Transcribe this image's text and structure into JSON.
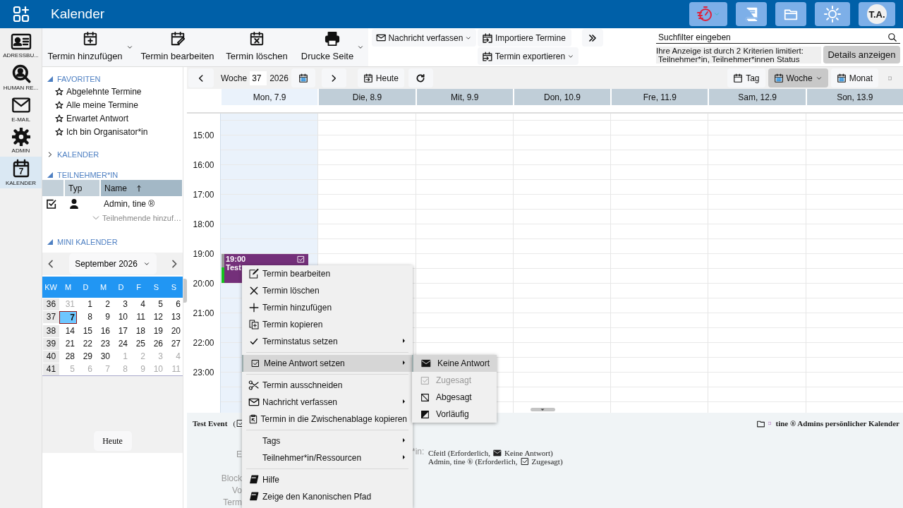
{
  "app": {
    "title": "Kalender",
    "avatar": "T.A."
  },
  "rail": [
    {
      "label": "ADRESSBU...",
      "selected": false
    },
    {
      "label": "HUMAN RE...",
      "selected": false
    },
    {
      "label": "E-MAIL",
      "selected": false
    },
    {
      "label": "ADMIN",
      "selected": false
    },
    {
      "label": "KALENDER",
      "selected": true,
      "day": "7"
    }
  ],
  "toolbar": {
    "actions": [
      {
        "label": "Termin hinzufügen",
        "dropdown": true
      },
      {
        "label": "Termin bearbeiten",
        "dropdown": false
      },
      {
        "label": "Termin löschen",
        "dropdown": false
      },
      {
        "label": "Drucke Seite",
        "dropdown": true
      }
    ],
    "small_actions": [
      {
        "label": "Nachricht verfassen",
        "dropdown": true
      },
      {
        "label": "Importiere Termine",
        "dropdown": false
      },
      {
        "label": "Termin exportieren",
        "dropdown": true
      }
    ],
    "search": {
      "placeholder": "Suchfilter eingeben"
    },
    "filter_notice": {
      "line_1": "Ihre Anzeige ist durch 2 Kriterien limitiert:",
      "line_2": "Teilnehmer*in, Teilnehmer*innen Status",
      "button": "Details anzeigen"
    }
  },
  "sidebar": {
    "favorites": {
      "title": "FAVORITEN",
      "expanded": true,
      "items": [
        "Abgelehnte Termine",
        "Alle meine Termine",
        "Erwartet Antwort",
        "Ich bin Organisator*in"
      ]
    },
    "calendars": {
      "title": "KALENDER",
      "expanded": false
    },
    "attendees": {
      "title": "TEILNEHMER*IN",
      "expanded": true,
      "columns": [
        {
          "label": "Typ",
          "sorted": false
        },
        {
          "label": "Name",
          "sorted": true
        }
      ],
      "rows": [
        {
          "checked": true,
          "name": "Admin, tine ®"
        }
      ],
      "add_placeholder": "Teilnehmende hinzuf…"
    },
    "mini_calendar": {
      "title": "MINI KALENDER",
      "expanded": true,
      "month": "September 2026",
      "header": [
        "KW",
        "M",
        "D",
        "M",
        "D",
        "F",
        "S",
        "S"
      ],
      "weeks": [
        {
          "week": "36",
          "days": [
            {
              "label": "31",
              "outside": true,
              "selected": false
            },
            {
              "label": "1",
              "outside": false,
              "selected": false
            },
            {
              "label": "2",
              "outside": false,
              "selected": false
            },
            {
              "label": "3",
              "outside": false,
              "selected": false
            },
            {
              "label": "4",
              "outside": false,
              "selected": false
            },
            {
              "label": "5",
              "outside": false,
              "selected": false
            },
            {
              "label": "6",
              "outside": false,
              "selected": false
            }
          ]
        },
        {
          "week": "37",
          "days": [
            {
              "label": "7",
              "outside": false,
              "selected": true
            },
            {
              "label": "8",
              "outside": false,
              "selected": false
            },
            {
              "label": "9",
              "outside": false,
              "selected": false
            },
            {
              "label": "10",
              "outside": false,
              "selected": false
            },
            {
              "label": "11",
              "outside": false,
              "selected": false
            },
            {
              "label": "12",
              "outside": false,
              "selected": false
            },
            {
              "label": "13",
              "outside": false,
              "selected": false
            }
          ]
        },
        {
          "week": "38",
          "days": [
            {
              "label": "14",
              "outside": false,
              "selected": false
            },
            {
              "label": "15",
              "outside": false,
              "selected": false
            },
            {
              "label": "16",
              "outside": false,
              "selected": false
            },
            {
              "label": "17",
              "outside": false,
              "selected": false
            },
            {
              "label": "18",
              "outside": false,
              "selected": false
            },
            {
              "label": "19",
              "outside": false,
              "selected": false
            },
            {
              "label": "20",
              "outside": false,
              "selected": false
            }
          ]
        },
        {
          "week": "39",
          "days": [
            {
              "label": "21",
              "outside": false,
              "selected": false
            },
            {
              "label": "22",
              "outside": false,
              "selected": false
            },
            {
              "label": "23",
              "outside": false,
              "selected": false
            },
            {
              "label": "24",
              "outside": false,
              "selected": false
            },
            {
              "label": "25",
              "outside": false,
              "selected": false
            },
            {
              "label": "26",
              "outside": false,
              "selected": false
            },
            {
              "label": "27",
              "outside": false,
              "selected": false
            }
          ]
        },
        {
          "week": "40",
          "days": [
            {
              "label": "28",
              "outside": false,
              "selected": false
            },
            {
              "label": "29",
              "outside": false,
              "selected": false
            },
            {
              "label": "30",
              "outside": false,
              "selected": false
            },
            {
              "label": "1",
              "outside": true,
              "selected": false
            },
            {
              "label": "2",
              "outside": true,
              "selected": false
            },
            {
              "label": "3",
              "outside": true,
              "selected": false
            },
            {
              "label": "4",
              "outside": true,
              "selected": false
            }
          ]
        },
        {
          "week": "41",
          "days": [
            {
              "label": "5",
              "outside": true,
              "selected": false
            },
            {
              "label": "6",
              "outside": true,
              "selected": false
            },
            {
              "label": "7",
              "outside": true,
              "selected": false
            },
            {
              "label": "8",
              "outside": true,
              "selected": false
            },
            {
              "label": "9",
              "outside": true,
              "selected": false
            },
            {
              "label": "10",
              "outside": true,
              "selected": false
            },
            {
              "label": "11",
              "outside": true,
              "selected": false
            }
          ]
        }
      ],
      "today_button": "Heute"
    }
  },
  "calendar": {
    "week_label": "Woche",
    "week": "37",
    "year": "2026",
    "today_button": "Heute",
    "views": [
      {
        "label": "Tag",
        "selected": false
      },
      {
        "label": "Woche",
        "selected": true
      },
      {
        "label": "Monat",
        "selected": false
      }
    ],
    "days": [
      {
        "label": "Mon, 7.9",
        "selected": true,
        "events": [
          {
            "time": "19:00",
            "title": "Test"
          }
        ]
      },
      {
        "label": "Die, 8.9",
        "selected": false
      },
      {
        "label": "Mit, 9.9",
        "selected": false
      },
      {
        "label": "Don, 10.9",
        "selected": false
      },
      {
        "label": "Fre, 11.9",
        "selected": false
      },
      {
        "label": "Sam, 12.9",
        "selected": false
      },
      {
        "label": "Son, 13.9",
        "selected": false
      }
    ],
    "hours": [
      "15:00",
      "16:00",
      "17:00",
      "18:00",
      "19:00",
      "20:00",
      "21:00",
      "22:00",
      "23:00"
    ]
  },
  "context_menu": {
    "groups": [
      {
        "items": [
          {
            "label": "Termin bearbeiten",
            "submenu": false,
            "selected": false
          },
          {
            "label": "Termin löschen",
            "submenu": false,
            "selected": false
          },
          {
            "label": "Termin hinzufügen",
            "submenu": false,
            "selected": false
          },
          {
            "label": "Termin kopieren",
            "submenu": false,
            "selected": false
          },
          {
            "label": "Terminstatus setzen",
            "submenu": true,
            "selected": false
          }
        ]
      },
      {
        "items": [
          {
            "label": "Meine Antwort setzen",
            "submenu": true,
            "selected": true,
            "items": [
              {
                "label": "Keine Antwort",
                "selected": true,
                "disabled": false
              },
              {
                "label": "Zugesagt",
                "selected": false,
                "disabled": true
              },
              {
                "label": "Abgesagt",
                "selected": false,
                "disabled": false
              },
              {
                "label": "Vorläufig",
                "selected": false,
                "disabled": false
              }
            ]
          }
        ]
      },
      {
        "items": [
          {
            "label": "Termin ausschneiden",
            "submenu": false,
            "selected": false
          },
          {
            "label": "Nachricht verfassen",
            "submenu": true,
            "selected": false
          },
          {
            "label": "Termin in die Zwischenablage kopieren",
            "submenu": false,
            "selected": false
          }
        ]
      },
      {
        "items": [
          {
            "label": "Tags",
            "submenu": true,
            "selected": false
          },
          {
            "label": "Teilnehmer*in/Ressourcen",
            "submenu": true,
            "selected": false
          }
        ]
      },
      {
        "items": [
          {
            "label": "Hilfe",
            "submenu": false,
            "selected": false
          },
          {
            "label": "Zeige den Kanonischen Pfad",
            "submenu": false,
            "selected": false
          }
        ]
      }
    ]
  },
  "details": {
    "title": "Test Event",
    "paren": "(",
    "calendar": "tine ® Admins persönlicher Kalender",
    "labels": [
      "E",
      "Block",
      "Vo",
      "Term"
    ],
    "attendee_label": "*in:",
    "attendees": [
      {
        "before": "Cfeitl (Erforderlich,",
        "status": "Keine Antwort)",
        "kind": "none"
      },
      {
        "before": "Admin, tine ® (Erforderlich,",
        "status": "Zugesagt)",
        "kind": "accepted"
      }
    ]
  }
}
